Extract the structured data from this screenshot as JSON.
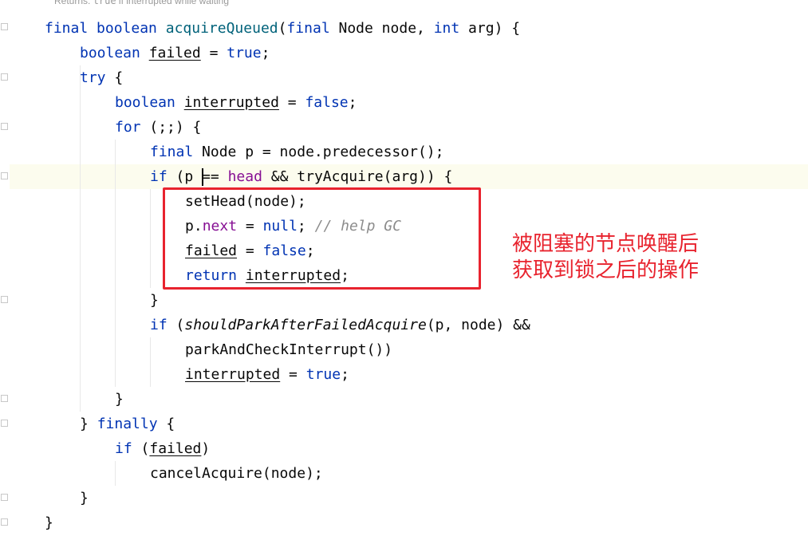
{
  "doc_hint": {
    "prefix": "Returns: ",
    "code": "true",
    "suffix": " if interrupted while waiting"
  },
  "code": {
    "l1": {
      "final": "final",
      "boolean": "boolean",
      "name": "acquireQueued",
      "paren": "(",
      "final2": "final",
      "type": " Node node, ",
      "int": "int",
      "rest": " arg) {"
    },
    "l2": {
      "boolean": "boolean",
      "var": "failed",
      "eq": " = ",
      "val": "true",
      "end": ";"
    },
    "l3": {
      "try": "try",
      "end": " {"
    },
    "l4": {
      "boolean": "boolean",
      "var": "interrupted",
      "eq": " = ",
      "val": "false",
      "end": ";"
    },
    "l5": {
      "for": "for",
      "end": " (;;) {"
    },
    "l6": {
      "final": "final",
      "rest": " Node p = node.predecessor();"
    },
    "l7": {
      "if": "if",
      "a": " (p ",
      "b": "== ",
      "head": "head",
      "c": " && tryAcquire(arg)) {"
    },
    "l8": {
      "text": "setHead(node);"
    },
    "l9": {
      "p": "p.",
      "next": "next",
      "eq": " = ",
      "null": "null",
      "semi": "; ",
      "comment": "// help GC"
    },
    "l10": {
      "var": "failed",
      "eq": " = ",
      "val": "false",
      "end": ";"
    },
    "l11": {
      "return": "return",
      "sp": " ",
      "var": "interrupted",
      "end": ";"
    },
    "l12": {
      "text": "}"
    },
    "l13": {
      "if": "if",
      "a": " (",
      "call": "shouldParkAfterFailedAcquire",
      "b": "(p, node) &&"
    },
    "l14": {
      "text": "parkAndCheckInterrupt())"
    },
    "l15": {
      "var": "interrupted",
      "eq": " = ",
      "val": "true",
      "end": ";"
    },
    "l16": {
      "text": "}"
    },
    "l17": {
      "a": "} ",
      "finally": "finally",
      "b": " {"
    },
    "l18": {
      "if": "if",
      "a": " (",
      "var": "failed",
      "b": ")"
    },
    "l19": {
      "text": "cancelAcquire(node);"
    },
    "l20": {
      "text": "}"
    },
    "l21": {
      "text": "}"
    }
  },
  "annotation": {
    "line1": "被阻塞的节点唤醒后",
    "line2": "获取到锁之后的操作"
  },
  "colors": {
    "keyword": "#0033b3",
    "method": "#00627a",
    "field": "#871094",
    "comment": "#8c8c8c",
    "annotation": "#e8232e"
  }
}
